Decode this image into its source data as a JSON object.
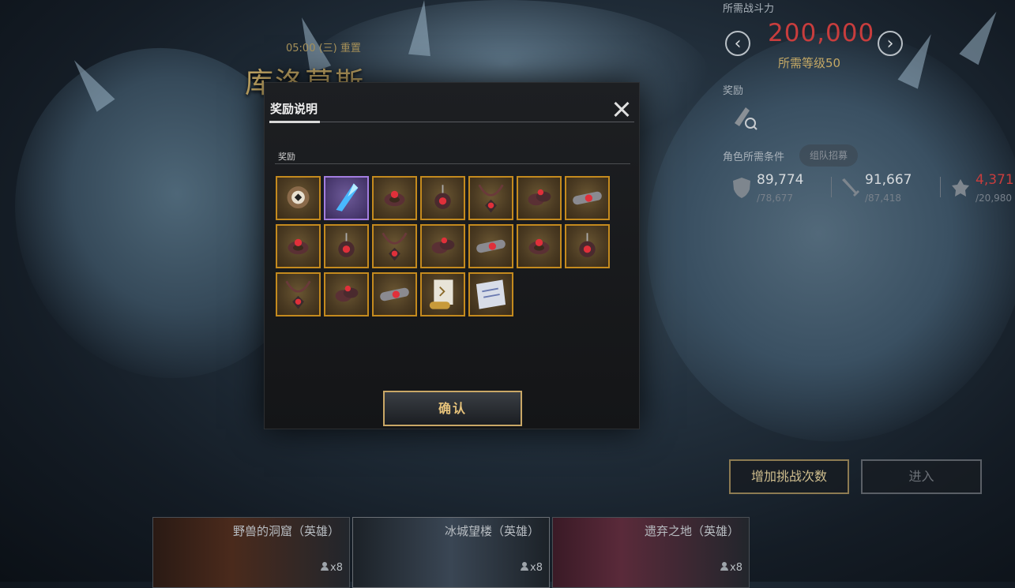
{
  "background": {
    "reset_text": "05:00 (三) 重置",
    "boss_title": "库洛莫斯"
  },
  "right_panel": {
    "power_label": "所需战斗力",
    "power_value": "200,000",
    "level_requirement": "所需等级50",
    "reward_label": "奖励",
    "conditions_label": "角色所需条件",
    "party_button": "组队招募",
    "stats": [
      {
        "icon": "shield-icon",
        "value": "89,774",
        "required": "/78,677",
        "color": "#d6dadd"
      },
      {
        "icon": "sword-icon",
        "value": "91,667",
        "required": "/87,418",
        "color": "#d6dadd"
      },
      {
        "icon": "emblem-icon",
        "value": "4,371",
        "required": "/20,980",
        "color": "#c83d3d"
      }
    ],
    "add_attempts_button": "增加挑战次数",
    "enter_button": "进入"
  },
  "dungeon_cards": [
    {
      "name": "野兽的洞窟（英雄）",
      "party": "x8"
    },
    {
      "name": "冰城望楼（英雄）",
      "party": "x8"
    },
    {
      "name": "遗弃之地（英雄）",
      "party": "x8"
    }
  ],
  "modal": {
    "title": "奖励说明",
    "section_label": "奖励",
    "confirm_button": "确认",
    "items": [
      {
        "icon": "emblem-badge-icon",
        "rarity": "gold"
      },
      {
        "icon": "blue-crystal-icon",
        "rarity": "purple"
      },
      {
        "icon": "ring-icon",
        "rarity": "gold"
      },
      {
        "icon": "earring-icon",
        "rarity": "gold"
      },
      {
        "icon": "necklace-icon",
        "rarity": "gold"
      },
      {
        "icon": "ring-pair-icon",
        "rarity": "gold"
      },
      {
        "icon": "bracelet-icon",
        "rarity": "gold"
      },
      {
        "icon": "ring-icon",
        "rarity": "gold"
      },
      {
        "icon": "earring-icon",
        "rarity": "gold"
      },
      {
        "icon": "necklace-icon",
        "rarity": "gold"
      },
      {
        "icon": "ring-pair-icon",
        "rarity": "gold"
      },
      {
        "icon": "bracelet-icon",
        "rarity": "gold"
      },
      {
        "icon": "ring-icon",
        "rarity": "gold"
      },
      {
        "icon": "earring-icon",
        "rarity": "gold"
      },
      {
        "icon": "necklace-icon",
        "rarity": "gold"
      },
      {
        "icon": "ring-pair-icon",
        "rarity": "gold"
      },
      {
        "icon": "bracelet-icon",
        "rarity": "gold"
      },
      {
        "icon": "scroll-icon",
        "rarity": "gold"
      },
      {
        "icon": "blueprint-icon",
        "rarity": "gold"
      }
    ]
  },
  "colors": {
    "gold_border": "#c48a1e",
    "purple_border": "#a37de0",
    "power_red": "#c83d3d",
    "title_gold": "#c4a865"
  }
}
